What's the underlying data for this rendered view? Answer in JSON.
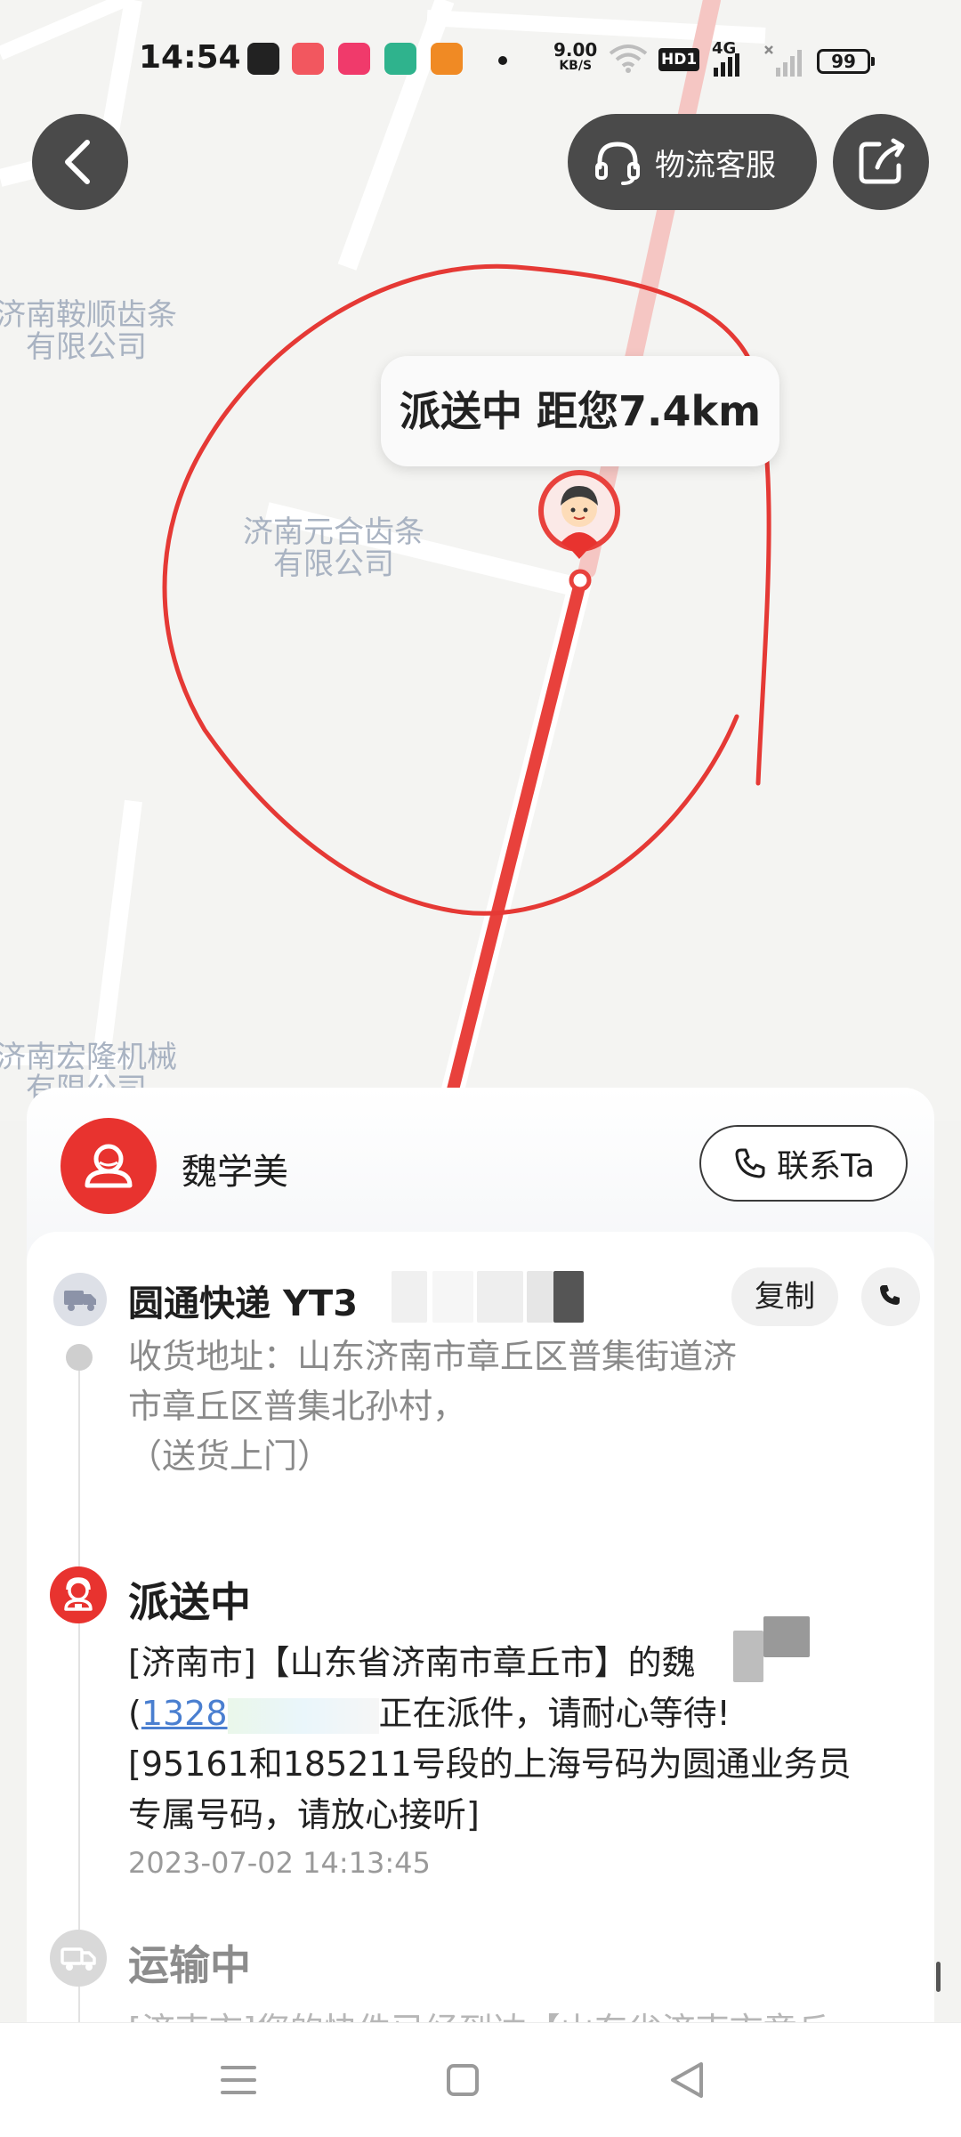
{
  "status_bar": {
    "time": "14:54",
    "net_speed": "9.00",
    "net_speed_unit": "KB/S",
    "hd_badge": "HD1",
    "network": "4G",
    "battery": "99"
  },
  "header": {
    "customer_service_label": "物流客服"
  },
  "map": {
    "labels": [
      [
        "济南鞍顺齿条",
        "有限公司"
      ],
      [
        "济南元合齿条",
        "有限公司"
      ],
      [
        "济南宏隆机械",
        "有限公司"
      ]
    ],
    "callout": "派送中 距您7.4km",
    "route_color": "#e8413c",
    "annotation_color": "#e53935"
  },
  "courier": {
    "name": "魏学美",
    "contact_label": "联系Ta"
  },
  "shipment": {
    "carrier": "圆通快递",
    "tracking_prefix": "YT3",
    "copy_label": "复制",
    "address_lines": [
      "收货地址：山东济南市章丘区普集街道济",
      "市章丘区普集北孙村，",
      "（送货上门）"
    ]
  },
  "timeline": {
    "current": {
      "status": "派送中",
      "line1": "[济南市]【山东省济南市章丘市】的魏",
      "phone_prefix": "(",
      "phone": "1328",
      "line2_suffix": "正在派件，请耐心等待!",
      "line3": "[95161和185211号段的上海号码为圆通业务员",
      "line4": "专属号码，请放心接听]",
      "time": "2023-07-02 14:13:45"
    },
    "next": {
      "status": "运输中",
      "text": "[济南市]您的快件已经到达【山东省济南市章丘"
    }
  },
  "colors": {
    "accent_red": "#e8332f",
    "link_blue": "#4a7fd0"
  }
}
